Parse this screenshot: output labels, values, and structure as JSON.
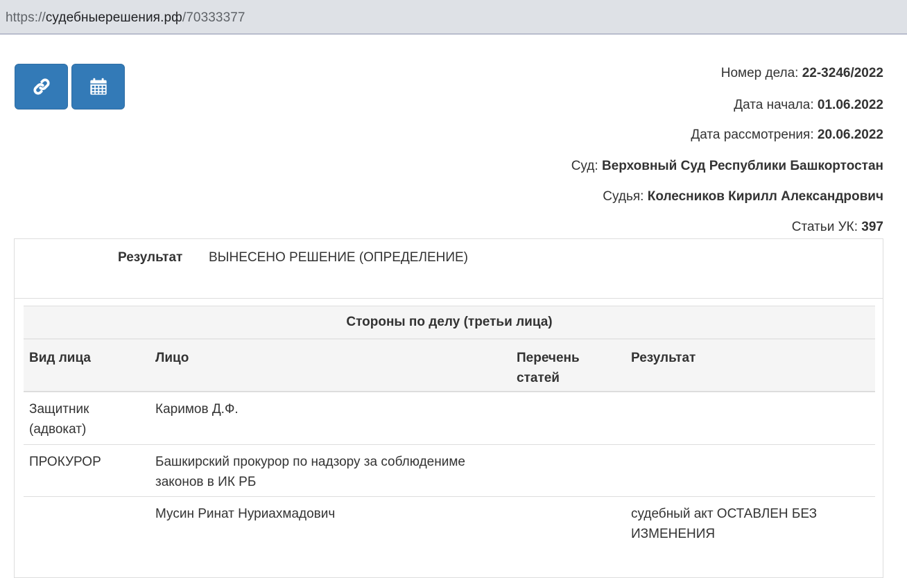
{
  "browser": {
    "url_scheme": "https://",
    "url_host": "судебныерешения.рф",
    "url_path": "/70333377"
  },
  "actions": {
    "link_icon": "link-icon",
    "calendar_icon": "calendar-icon",
    "accent_color": "#337ab7"
  },
  "case": {
    "number_label": "Номер дела:",
    "number_value": "22-3246/2022",
    "start_label": "Дата начала:",
    "start_value": "01.06.2022",
    "review_label": "Дата рассмотрения:",
    "review_value": "20.06.2022",
    "court_label": "Суд:",
    "court_value": "Верховный Суд Республики Башкортостан",
    "judge_label": "Судья:",
    "judge_value": "Колесников Кирилл Александрович",
    "articles_label": "Статьи УК:",
    "articles_value": "397"
  },
  "result": {
    "label": "Результат",
    "value": "ВЫНЕСЕНО РЕШЕНИЕ (ОПРЕДЕЛЕНИЕ)"
  },
  "parties": {
    "caption": "Стороны по делу (третьи лица)",
    "headers": [
      "Вид лица",
      "Лицо",
      "Перечень статей",
      "Результат"
    ],
    "rows": [
      [
        "Защитник (адвокат)",
        "Каримов Д.Ф.",
        "",
        ""
      ],
      [
        "ПРОКУРОР",
        "Башкирский прокурор по надзору за соблюдениме законов в ИК РБ",
        "",
        ""
      ],
      [
        "",
        "Мусин Ринат Нуриахмадович",
        "",
        "судебный акт ОСТАВЛЕН БЕЗ ИЗМЕНЕНИЯ"
      ]
    ]
  }
}
